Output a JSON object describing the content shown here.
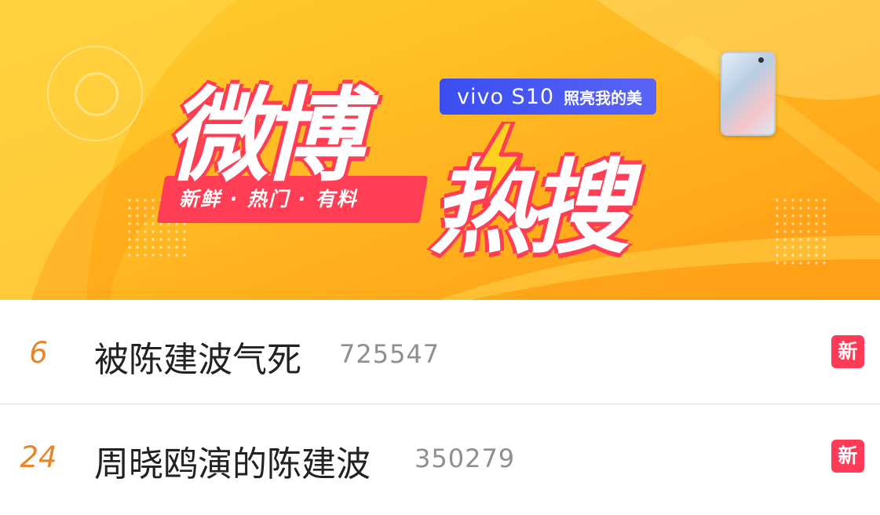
{
  "banner": {
    "title_main": "微博",
    "title_sub": "热搜",
    "slogan": "新鲜 · 热门 · 有料",
    "sponsor": {
      "brand": "vivo S10",
      "tagline": "照亮我的美"
    },
    "colors": {
      "background": "#ffbf25",
      "accent_red": "#ff3e56",
      "sponsor_blue": "#3a4ef0"
    }
  },
  "hot_list": [
    {
      "rank": "6",
      "title": "被陈建波气死",
      "count": "725547",
      "badge": "新"
    },
    {
      "rank": "24",
      "title": "周晓鸥演的陈建波",
      "count": "350279",
      "badge": "新"
    }
  ],
  "colors": {
    "rank": "#e7852b",
    "badge": "#ff3b57",
    "count": "#8f8f8f"
  }
}
